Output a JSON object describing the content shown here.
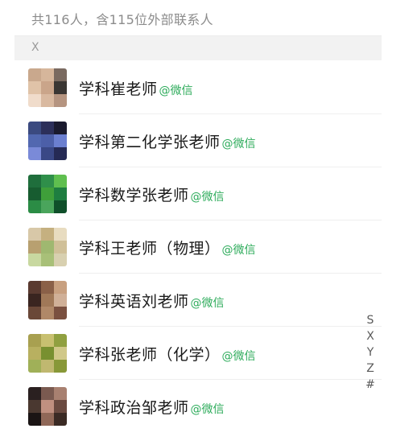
{
  "summary": {
    "text": "共116人，含115位外部联系人"
  },
  "section": {
    "letter": "X"
  },
  "contacts": [
    {
      "name": "学科崔老师",
      "tag": "@微信",
      "avatar_colors": [
        "#c9a88d",
        "#d6b69b",
        "#7a6a60",
        "#e0c3a8",
        "#caa58a",
        "#3a3633",
        "#f0dccb",
        "#d9b9a0",
        "#b59480"
      ]
    },
    {
      "name": "学科第二化学张老师",
      "tag": "@微信",
      "avatar_colors": [
        "#3b4a80",
        "#2c2f5a",
        "#1a1a2e",
        "#5268b0",
        "#4c5fa8",
        "#6b7fd0",
        "#7a8ad8",
        "#3a4886",
        "#252a55"
      ]
    },
    {
      "name": "学科数学张老师",
      "tag": "@微信",
      "avatar_colors": [
        "#1f6e3c",
        "#2f8f4a",
        "#5fbf4f",
        "#175c30",
        "#3f9f3a",
        "#1e7e40",
        "#2b8c45",
        "#4aa55c",
        "#0f4f2a"
      ]
    },
    {
      "name": "学科王老师（物理）",
      "tag": "@微信",
      "avatar_colors": [
        "#d8c8a8",
        "#c5b080",
        "#e8dcc0",
        "#b8a070",
        "#9fb870",
        "#d0c098",
        "#c8d8a0",
        "#a8c078",
        "#d8d0b0"
      ]
    },
    {
      "name": "学科英语刘老师",
      "tag": "@微信",
      "avatar_colors": [
        "#5a3a30",
        "#8a6048",
        "#c8a080",
        "#3a2520",
        "#a07858",
        "#d0b098",
        "#6a4838",
        "#b08868",
        "#7a5040"
      ]
    },
    {
      "name": "学科张老师（化学）",
      "tag": "@微信",
      "avatar_colors": [
        "#a8a050",
        "#c8c070",
        "#90a040",
        "#b8b060",
        "#789030",
        "#d0c888",
        "#a0b058",
        "#c0b870",
        "#889838"
      ]
    },
    {
      "name": "学科政治邹老师",
      "tag": "@微信",
      "avatar_colors": [
        "#2a2020",
        "#7a5a50",
        "#a88070",
        "#4a3830",
        "#c09080",
        "#6a4a40",
        "#1a1414",
        "#906858",
        "#3a2a24"
      ]
    }
  ],
  "index_bar": [
    "S",
    "X",
    "Y",
    "Z",
    "#"
  ]
}
